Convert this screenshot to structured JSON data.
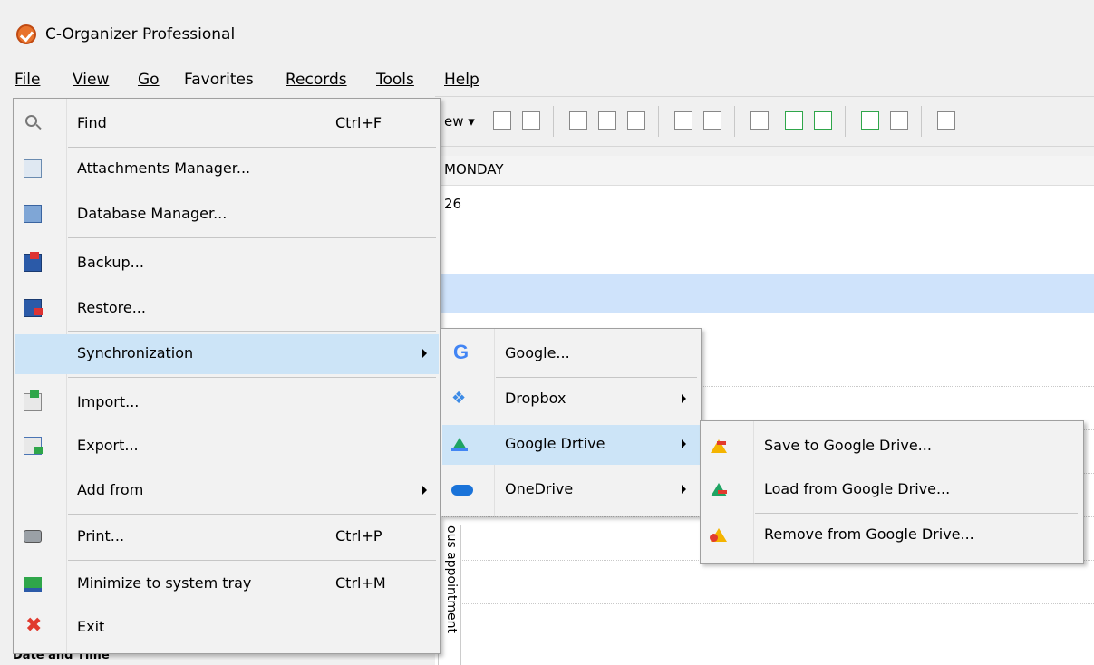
{
  "window": {
    "title": "C-Organizer Professional"
  },
  "menubar": {
    "file": "File",
    "view": "View",
    "go": "Go",
    "favorites": "Favorites",
    "records": "Records",
    "tools": "Tools",
    "help": "Help"
  },
  "toolbar": {
    "new_fragment": "ew ▾"
  },
  "calendar": {
    "day_header": "MONDAY",
    "date": "26",
    "vertical_label": "ous appointment"
  },
  "sidebar": {
    "bottom_fragment": "Date and Time"
  },
  "file_menu": {
    "items": [
      {
        "label": "Find",
        "shortcut": "Ctrl+F",
        "icon": "search-icon"
      },
      {
        "label": "Attachments Manager...",
        "icon": "attachments-icon"
      },
      {
        "label": "Database Manager...",
        "icon": "database-icon"
      },
      {
        "label": "Backup...",
        "icon": "backup-icon"
      },
      {
        "label": "Restore...",
        "icon": "restore-icon"
      },
      {
        "label": "Synchronization",
        "icon": "none",
        "submenu": true,
        "highlighted": true
      },
      {
        "label": "Import...",
        "icon": "import-icon"
      },
      {
        "label": "Export...",
        "icon": "export-icon"
      },
      {
        "label": "Add from",
        "icon": "none",
        "submenu": true
      },
      {
        "label": "Print...",
        "shortcut": "Ctrl+P",
        "icon": "printer-icon"
      },
      {
        "label": "Minimize to system tray",
        "shortcut": "Ctrl+M",
        "icon": "tray-icon"
      },
      {
        "label": "Exit",
        "icon": "close-icon"
      }
    ]
  },
  "sync_menu": {
    "items": [
      {
        "label": "Google...",
        "icon": "google-icon"
      },
      {
        "label": "Dropbox",
        "icon": "dropbox-icon",
        "submenu": true
      },
      {
        "label": "Google Drtive",
        "icon": "google-drive-icon",
        "submenu": true,
        "highlighted": true
      },
      {
        "label": "OneDrive",
        "icon": "onedrive-icon",
        "submenu": true
      }
    ]
  },
  "gdrive_menu": {
    "items": [
      {
        "label": "Save to Google Drive...",
        "icon": "gdrive-save-icon"
      },
      {
        "label": "Load from Google Drive...",
        "icon": "gdrive-load-icon"
      },
      {
        "label": "Remove from Google Drive...",
        "icon": "gdrive-remove-icon"
      }
    ]
  },
  "colors": {
    "highlight": "#cce4f7",
    "menu_bg": "#f2f2f2",
    "band": "#cfe3fb"
  }
}
